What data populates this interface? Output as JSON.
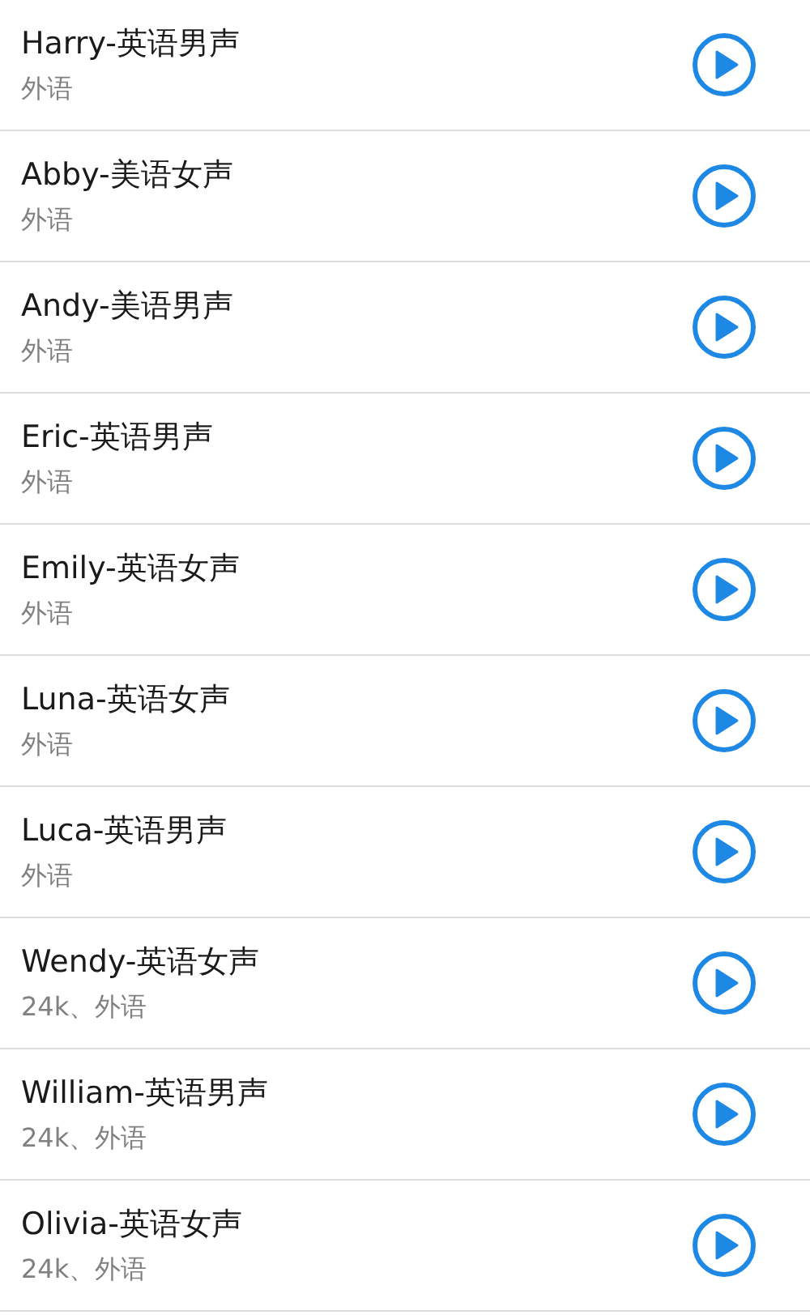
{
  "voices": [
    {
      "name": "Harry-英语男声",
      "detail": "外语"
    },
    {
      "name": "Abby-美语女声",
      "detail": "外语"
    },
    {
      "name": "Andy-美语男声",
      "detail": "外语"
    },
    {
      "name": "Eric-英语男声",
      "detail": "外语"
    },
    {
      "name": "Emily-英语女声",
      "detail": "外语"
    },
    {
      "name": "Luna-英语女声",
      "detail": "外语"
    },
    {
      "name": "Luca-英语男声",
      "detail": "外语"
    },
    {
      "name": "Wendy-英语女声",
      "detail": "24k、外语"
    },
    {
      "name": "William-英语男声",
      "detail": "24k、外语"
    },
    {
      "name": "Olivia-英语女声",
      "detail": "24k、外语"
    }
  ]
}
